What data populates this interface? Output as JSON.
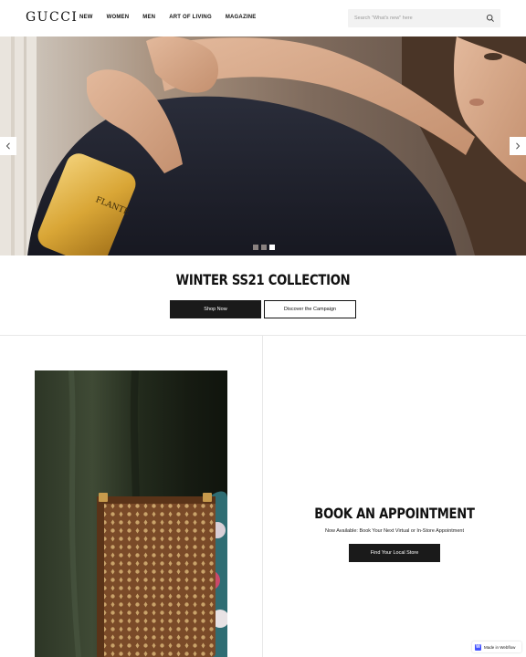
{
  "header": {
    "logo": "GUCCI",
    "nav": [
      {
        "label": "NEW"
      },
      {
        "label": "WOMEN"
      },
      {
        "label": "MEN"
      },
      {
        "label": "ART OF LIVING"
      },
      {
        "label": "MAGAZINE"
      }
    ],
    "search_placeholder": "Search \"What's new\" here",
    "search_icon": "search-icon"
  },
  "hero": {
    "prev_icon": "chevron-left-icon",
    "next_icon": "chevron-right-icon",
    "slide_count": 3,
    "active_slide": 3,
    "bottle_text": "FLANTE"
  },
  "collection": {
    "title": "WINTER SS21 COLLECTION",
    "primary_button": "Shop Now",
    "secondary_button": "Discover the Campaign"
  },
  "appointment": {
    "title": "BOOK AN APPOINTMENT",
    "subtitle": "Now Available: Book Your Next Virtual or In-Store Appointment",
    "button": "Find Your Local Store"
  },
  "badge": {
    "icon": "webflow-icon",
    "logo_letter": "W",
    "label": "Made in Webflow"
  },
  "colors": {
    "dark_button": "#1a1a1a",
    "search_bg": "#f2f2f2",
    "webflow_blue": "#4353ff"
  }
}
